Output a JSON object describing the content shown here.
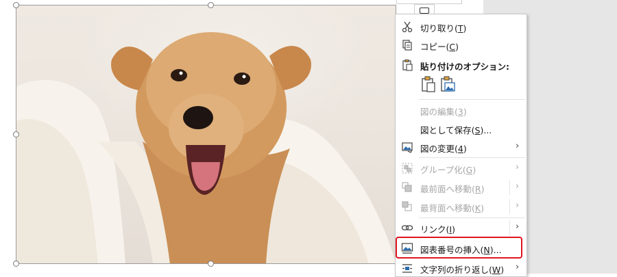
{
  "window": {
    "accent_highlight_color": "#e0141e"
  },
  "document": {
    "image": {
      "subject": "dog-photo"
    }
  },
  "context_menu": {
    "items": [
      {
        "label": "切り取り(",
        "key": "T",
        "suffix": ")",
        "icon": "scissors-icon",
        "enabled": true
      },
      {
        "label": "コピー(",
        "key": "C",
        "suffix": ")",
        "icon": "copy-icon",
        "enabled": true
      },
      {
        "label": "貼り付けのオプション:",
        "icon": "paste-options-icon",
        "enabled": true
      },
      {
        "label": "図の編集(",
        "key": "3",
        "suffix": ")",
        "enabled": false
      },
      {
        "label": "図として保存(",
        "key": "S",
        "suffix": ")...",
        "enabled": true
      },
      {
        "label": "図の変更(",
        "key": "4",
        "suffix": ")",
        "icon": "change-picture-icon",
        "enabled": true,
        "submenu": true
      },
      {
        "label": "グループ化(",
        "key": "G",
        "suffix": ")",
        "icon": "group-icon",
        "enabled": false,
        "submenu": true
      },
      {
        "label": "最前面へ移動(",
        "key": "R",
        "suffix": ")",
        "icon": "bring-to-front-icon",
        "enabled": false,
        "submenu": true
      },
      {
        "label": "最背面へ移動(",
        "key": "K",
        "suffix": ")",
        "icon": "send-to-back-icon",
        "enabled": false,
        "submenu": true
      },
      {
        "label": "リンク(",
        "key": "I",
        "suffix": ")",
        "icon": "link-icon",
        "enabled": true,
        "submenu": true
      },
      {
        "label": "図表番号の挿入(",
        "key": "N",
        "suffix": ")...",
        "icon": "insert-caption-icon",
        "enabled": true,
        "highlighted": true
      },
      {
        "label": "文字列の折り返し(",
        "key": "W",
        "suffix": ")",
        "icon": "wrap-text-icon",
        "enabled": true,
        "submenu": true
      }
    ],
    "paste_options": [
      "paste-keep-format-icon",
      "paste-picture-icon"
    ],
    "submenu_arrow": "›"
  }
}
